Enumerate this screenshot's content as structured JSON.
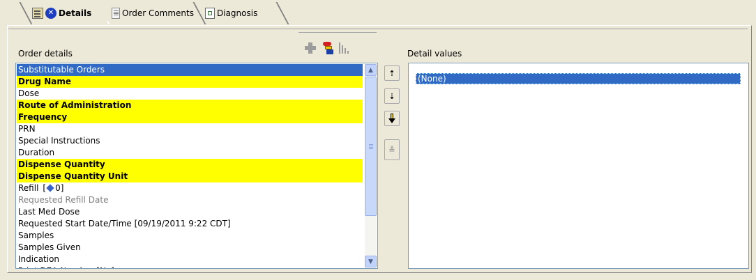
{
  "tabs": [
    {
      "label": "Details",
      "active": true,
      "icons": [
        "properties-icon",
        "remove-x-icon"
      ]
    },
    {
      "label": "Order Comments",
      "active": false,
      "icons": [
        "document-icon"
      ]
    },
    {
      "label": "Diagnosis",
      "active": false,
      "icons": [
        "diagnosis-icon"
      ]
    }
  ],
  "order_details": {
    "label": "Order details",
    "items": [
      {
        "text": "Substitutable Orders",
        "state": "selected"
      },
      {
        "text": "Drug Name",
        "state": "required"
      },
      {
        "text": "Dose",
        "state": "normal"
      },
      {
        "text": "Route of Administration",
        "state": "required"
      },
      {
        "text": "Frequency",
        "state": "required"
      },
      {
        "text": "PRN",
        "state": "normal"
      },
      {
        "text": "Special Instructions",
        "state": "normal"
      },
      {
        "text": "Duration",
        "state": "normal"
      },
      {
        "text": "Dispense Quantity",
        "state": "required"
      },
      {
        "text": "Dispense Quantity Unit",
        "state": "required"
      },
      {
        "text": "Refill",
        "suffix_before": "[",
        "suffix_value": "0]",
        "state": "normal",
        "has_diamond": true
      },
      {
        "text": "Requested Refill Date",
        "state": "disabled"
      },
      {
        "text": "Last Med Dose",
        "state": "normal"
      },
      {
        "text": "Requested Start Date/Time   [09/19/2011 9:22 CDT]",
        "state": "normal"
      },
      {
        "text": "Samples",
        "state": "normal"
      },
      {
        "text": "Samples Given",
        "state": "normal"
      },
      {
        "text": "Indication",
        "state": "normal"
      },
      {
        "text": "Print DEA Number   [No]",
        "state": "normal"
      }
    ]
  },
  "detail_values": {
    "label": "Detail values",
    "items": [
      "(None)"
    ]
  },
  "colors": {
    "selection": "#316ac5",
    "required": "#ffff00",
    "background": "#ece9d8"
  }
}
